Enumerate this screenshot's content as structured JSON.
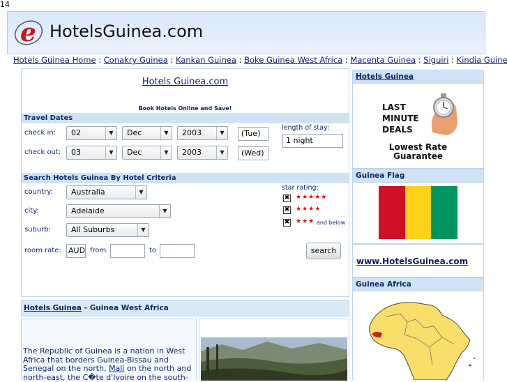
{
  "page_number": "14",
  "brand": {
    "logo_letter": "e",
    "name": "HotelsGuinea.com"
  },
  "nav": {
    "links": [
      "Hotels Guinea Home",
      "Conakry Guinea",
      "Kankan Guinea",
      "Boke Guinea West Africa",
      "Macenta Guinea",
      "Siguiri",
      "Kindia Guinea"
    ],
    "separator": " : "
  },
  "main": {
    "site_link": "Hotels Guinea.com",
    "tagline": "Book Hotels Online and Save!",
    "travel_dates": {
      "heading": "Travel Dates",
      "checkin_label": "check in:",
      "checkout_label": "check out:",
      "checkin": {
        "day": "02",
        "month": "Dec",
        "year": "2003",
        "weekday": "(Tue)"
      },
      "checkout": {
        "day": "03",
        "month": "Dec",
        "year": "2003",
        "weekday": "(Wed)"
      },
      "stay_label": "length of stay:",
      "stay_value": "1 night"
    },
    "criteria": {
      "heading": "Search Hotels Guinea By Hotel Criteria",
      "country_label": "country:",
      "country_value": "Australia",
      "city_label": "city:",
      "city_value": "Adelaide",
      "suburb_label": "suburb:",
      "suburb_value": "All Suburbs",
      "room_rate_label": "room rate:",
      "currency": "AUD",
      "from_label": "from",
      "to_label": "to",
      "star_label": "star rating:",
      "stars": [
        "★★★★★",
        "★★★★",
        "★★★"
      ],
      "and_below": "and below",
      "check_mark": "✖",
      "search_button": "search"
    }
  },
  "info": {
    "link": "Hotels Guinea",
    "rest": " - Guinea West Africa",
    "desc_before": "The Republic of Guinea is a nation in West Africa that borders Guinea-Bissau and Senegal on the north, ",
    "desc_link": "Mali",
    "desc_after": " on the north and north-east, the C�te d'Ivoire on the south-"
  },
  "sidebar": {
    "hotels_title": "Hotels Guinea",
    "deals_lines": [
      "LAST",
      "MINUTE",
      "DEALS"
    ],
    "guarantee": [
      "Lowest Rate",
      "Guarantee"
    ],
    "flag_title": "Guinea Flag",
    "flag_colors": [
      "#ce1126",
      "#fcd116",
      "#009460"
    ],
    "www_link": "www.HotelsGuinea.com",
    "africa_title": "Guinea Africa"
  }
}
